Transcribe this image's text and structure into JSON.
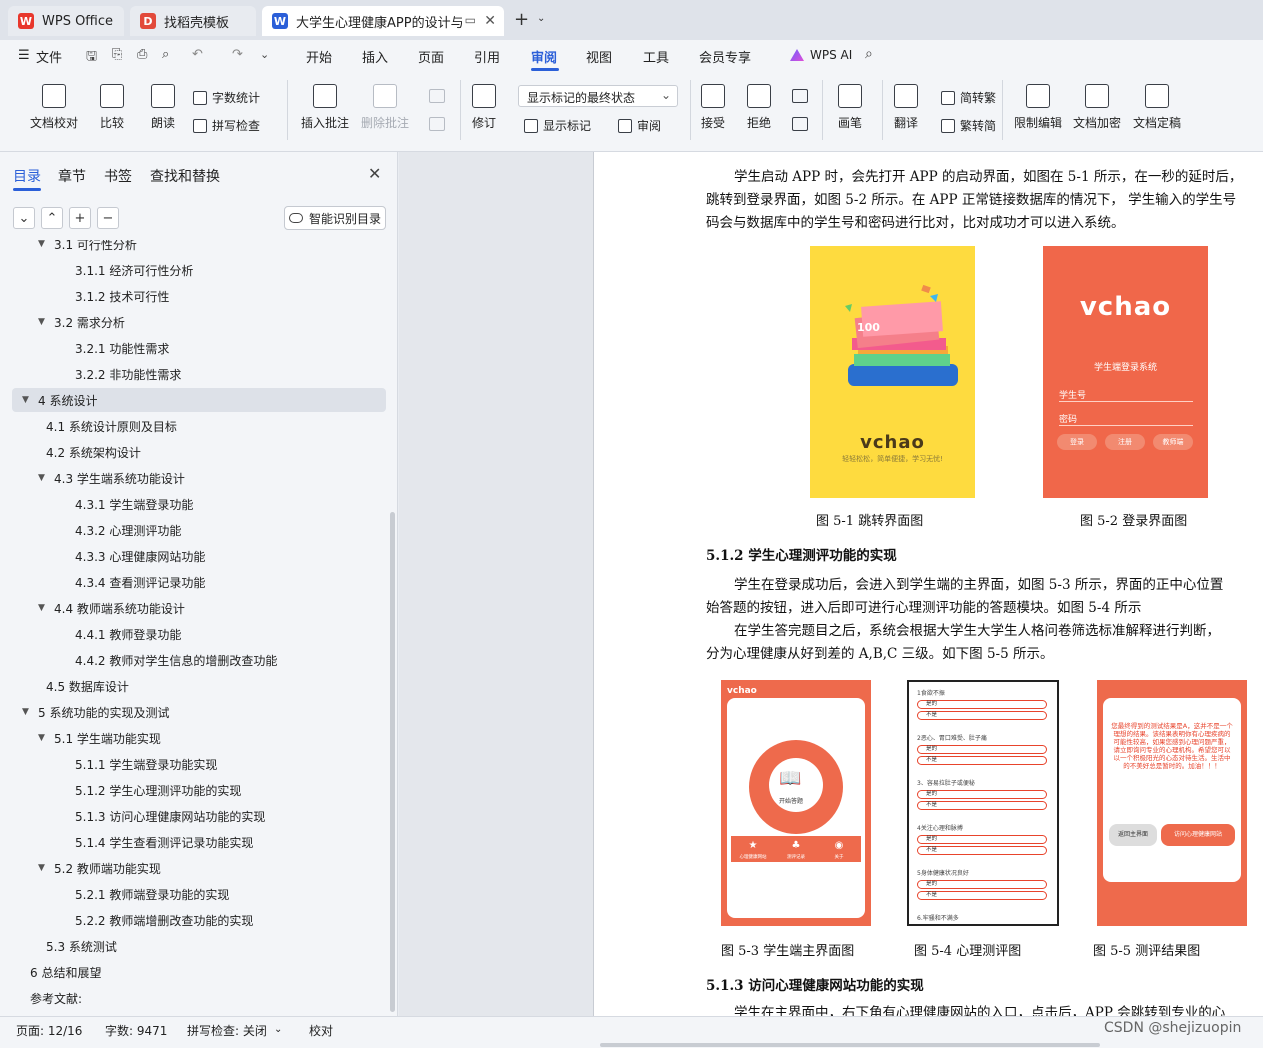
{
  "tabs": [
    {
      "label": "WPS Office",
      "icon": "wps-icon"
    },
    {
      "label": "找稻壳模板",
      "icon": "docer-icon"
    },
    {
      "label": "大学生心理健康APP的设计与实",
      "icon": "word-doc-icon"
    }
  ],
  "menu": {
    "items": [
      "文件",
      "开始",
      "插入",
      "页面",
      "引用",
      "审阅",
      "视图",
      "工具",
      "会员专享",
      "WPS AI"
    ],
    "active": "审阅"
  },
  "ribbon": {
    "doc_check": "文档校对",
    "compare": "比较",
    "read_aloud": "朗读",
    "word_count": "字数统计",
    "spell_check": "拼写检查",
    "insert_comment": "插入批注",
    "delete_comment": "删除批注",
    "revise": "修订",
    "markup_combo": "显示标记的最终状态",
    "show_markup": "显示标记",
    "review": "审阅",
    "accept": "接受",
    "reject": "拒绝",
    "pen": "画笔",
    "translate": "翻译",
    "to_traditional": "简转繁",
    "to_simplified": "繁转简",
    "restrict_edit": "限制编辑",
    "encrypt": "文档加密",
    "finalize": "文档定稿"
  },
  "nav": {
    "tabs": [
      "目录",
      "章节",
      "书签",
      "查找和替换"
    ],
    "smart_toc": "智能识别目录",
    "toc": [
      {
        "label": "3.1 可行性分析",
        "level": 2,
        "caret": true
      },
      {
        "label": "3.1.1 经济可行性分析",
        "level": 3
      },
      {
        "label": "3.1.2 技术可行性",
        "level": 3
      },
      {
        "label": "3.2 需求分析",
        "level": 2,
        "caret": true
      },
      {
        "label": "3.2.1 功能性需求",
        "level": 3
      },
      {
        "label": "3.2.2  非功能性需求",
        "level": 3
      },
      {
        "label": "4 系统设计",
        "level": 1,
        "caret": true,
        "selected": true
      },
      {
        "label": "4.1 系统设计原则及目标",
        "level": 2
      },
      {
        "label": "4.2  系统架构设计",
        "level": 2
      },
      {
        "label": "4.3 学生端系统功能设计",
        "level": 2,
        "caret": true
      },
      {
        "label": "4.3.1 学生端登录功能",
        "level": 3
      },
      {
        "label": "4.3.2 心理测评功能",
        "level": 3
      },
      {
        "label": "4.3.3 心理健康网站功能",
        "level": 3
      },
      {
        "label": "4.3.4  查看测评记录功能",
        "level": 3
      },
      {
        "label": "4.4 教师端系统功能设计",
        "level": 2,
        "caret": true
      },
      {
        "label": "4.4.1 教师登录功能",
        "level": 3
      },
      {
        "label": "4.4.2 教师对学生信息的增删改查功能",
        "level": 3
      },
      {
        "label": "4.5  数据库设计",
        "level": 2
      },
      {
        "label": "5 系统功能的实现及测试",
        "level": 1,
        "caret": true
      },
      {
        "label": "5.1 学生端功能实现",
        "level": 2,
        "caret": true
      },
      {
        "label": "5.1.1 学生端登录功能实现",
        "level": 3
      },
      {
        "label": "5.1.2 学生心理测评功能的实现",
        "level": 3
      },
      {
        "label": "5.1.3 访问心理健康网站功能的实现",
        "level": 3
      },
      {
        "label": "5.1.4 学生查看测评记录功能实现",
        "level": 3
      },
      {
        "label": "5.2 教师端功能实现",
        "level": 2,
        "caret": true
      },
      {
        "label": "5.2.1 教师端登录功能的实现",
        "level": 3
      },
      {
        "label": "5.2.2  教师端增删改查功能的实现",
        "level": 3
      },
      {
        "label": "5.3 系统测试",
        "level": 2
      },
      {
        "label": "6 总结和展望",
        "level": 1
      },
      {
        "label": "参考文献:",
        "level": 1
      }
    ]
  },
  "doc": {
    "p1": [
      "学生启动 APP 时，会先打开 APP 的启动界面，如图在 5-1 所示，在一秒的延时后，",
      "跳转到登录界面，如图 5-2 所示。在 APP 正常链接数据库的情况下，  学生输入的学生号",
      "码会与数据库中的学生号和密码进行比对，比对成功才可以进入系统。"
    ],
    "fig1_caption": "图  5-1    跳转界面图",
    "fig2_caption": "图  5-2    登录界面图",
    "h512": "5.1.2 学生心理测评功能的实现",
    "p2": [
      "学生在登录成功后，会进入到学生端的主界面，如图 5-3 所示，界面的正中心位置",
      "始答题的按钮，进入后即可进行心理测评功能的答题模块。如图 5-4 所示"
    ],
    "p3": [
      "在学生答完题目之后，系统会根据大学生大学生人格问卷筛选标准解释进行判断，",
      "分为心理健康从好到差的 A,B,C 三级。如下图 5-5 所示。"
    ],
    "fig3_caption": "图  5-3    学生端主界面图",
    "fig4_caption": "图  5-4   心理测评图",
    "fig5_caption": "图  5-5     测评结果图",
    "h513": "5.1.3 访问心理健康网站功能的实现",
    "p4": "学生在主界面中，右下角有心理健康网站的入口，点击后，APP 会跳转到专业的心",
    "splash": {
      "brand": "vchao",
      "badge": "100",
      "slogan": "轻轻松松，简单便捷，学习无忧!"
    },
    "login": {
      "brand": "vchao",
      "title": "学生端登录系统",
      "field1": "学生号",
      "field2": "密码",
      "btn1": "登录",
      "btn2": "注册",
      "btn3": "教师端"
    },
    "home": {
      "brand": "vchao",
      "start": "开始答题",
      "nav1": "心理健康网站",
      "nav2": "测评记录",
      "nav3": "关于"
    },
    "quiz": {
      "questions": [
        "1食欲不振",
        "2恶心、胃口难受、肚子痛",
        "3、容易拉肚子或便秘",
        "4关注心理和脉搏",
        "5身体健康状况良好",
        "6.牢骚和不满多"
      ],
      "yes": "是的",
      "no": "不是"
    },
    "result": {
      "text": "您最终得到的测试结果是A，这并不是一个理想的结果。该结果表明你有心理疾病的可能性较高，如果您感到心理问题严重，请立即询问专业的心理机构。希望您可以以一个积极阳光的心态对待生活。生活中的不美好总是暂时的。加油！！！",
      "btn_back": "返回主界面",
      "btn_visit": "访问心理健康网站"
    }
  },
  "status": {
    "page": "页面: 12/16",
    "words": "字数: 9471",
    "spell": "拼写检查: 关闭",
    "proof": "校对",
    "watermark": "CSDN @shejizuopin"
  },
  "colors": {
    "accent": "#2b5fd8",
    "splash_bg": "#fedb3f",
    "login_bg": "#f0674a",
    "phone_orange": "#ee6a4c"
  }
}
